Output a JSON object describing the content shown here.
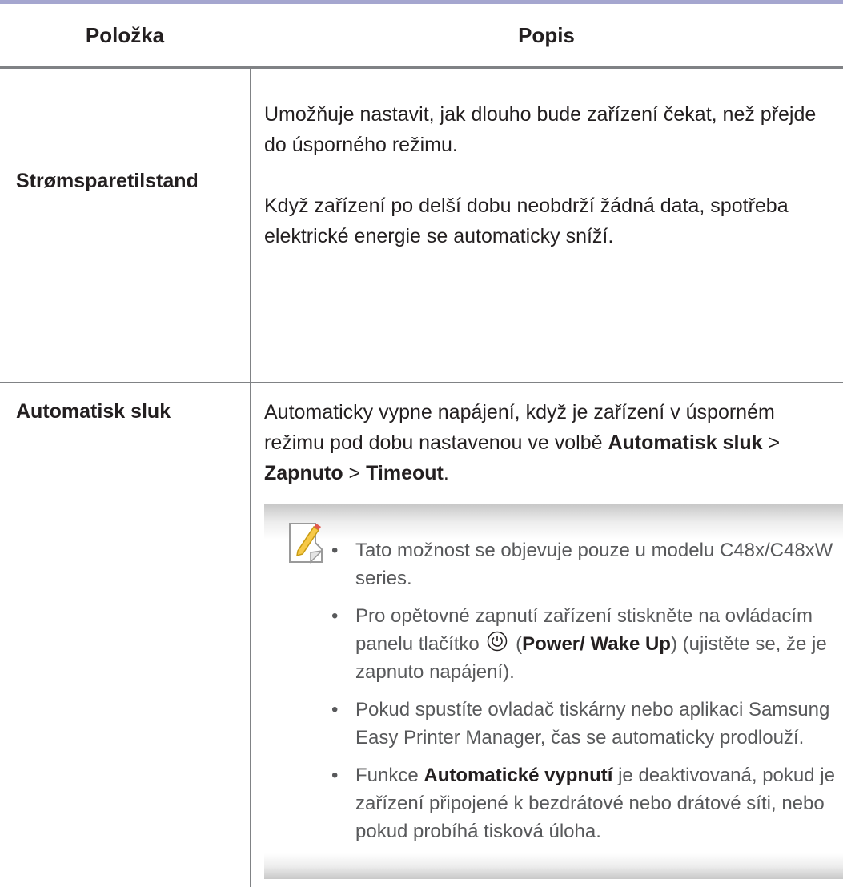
{
  "header": {
    "col_item": "Položka",
    "col_desc": "Popis"
  },
  "rows": [
    {
      "name": "Strømsparetilstand",
      "paragraphs": [
        "Umožňuje nastavit, jak dlouho bude zařízení čekat, než přejde do úsporného režimu.",
        "Když zařízení po delší dobu neobdrží žádná data, spotřeba elektrické energie se automaticky sníží."
      ]
    },
    {
      "name": "Automatisk sluk",
      "intro": "Automaticky vypne napájení, když je zařízení v úsporném režimu pod dobu nastavenou ve volbě",
      "path": [
        "Automatisk sluk",
        "Zapnuto",
        "Timeout"
      ],
      "path_sep": ">",
      "path_end": "."
    }
  ],
  "note": {
    "icon": "note-pencil-icon",
    "items": [
      {
        "text": "Tato možnost se objevuje pouze u modelu C48x/C48xW series."
      },
      {
        "before": "Pro opětovné zapnutí zařízení stiskněte na ovládacím panelu tlačítko",
        "icon": "power-icon",
        "paren_open": "(",
        "bold": "Power/ Wake Up",
        "after": ") (ujistěte se, že je zapnuto napájení)."
      },
      {
        "text": "Pokud spustíte ovladač tiskárny nebo aplikaci Samsung Easy Printer Manager, čas se automaticky prodlouží."
      },
      {
        "before": "Funkce",
        "bold": "Automatické vypnutí",
        "after": "je deaktivovaná, pokud je zařízení připojené k bezdrátové nebo drátové síti, nebo pokud probíhá tisková úloha."
      }
    ]
  },
  "colors": {
    "rule": "#a5a6cf",
    "border": "#808285",
    "text": "#231f20",
    "note_text": "#58595b"
  }
}
